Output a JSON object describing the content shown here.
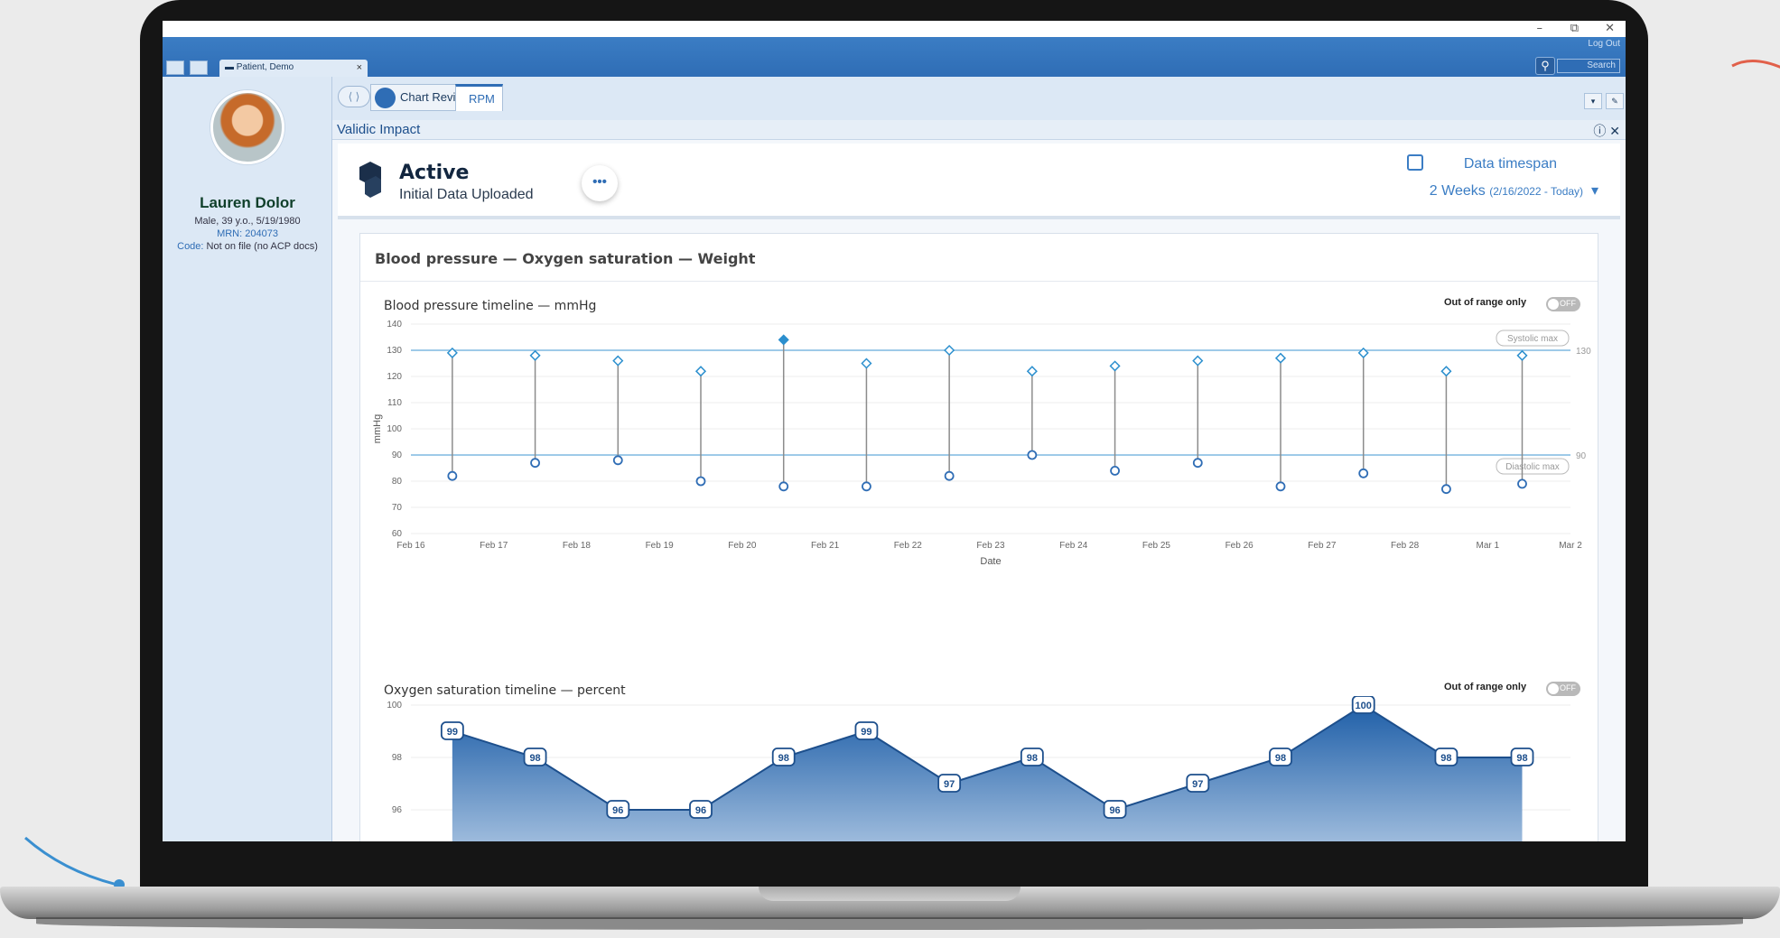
{
  "window": {
    "minimize": "–",
    "restore": "⧉",
    "close": "✕"
  },
  "header": {
    "patient_tab": "Patient, Demo",
    "patient_tab_close": "×",
    "logout": "Log Out",
    "search_placeholder": "Search"
  },
  "patient": {
    "name": "Lauren Dolor",
    "demographics": "Male, 39 y.o., 5/19/1980",
    "mrn": "MRN: 204073",
    "code_label": "Code:",
    "code_value": "Not on file (no ACP docs)"
  },
  "nav": {
    "tabs": [
      {
        "label": "Chart Review"
      },
      {
        "label": "RPM"
      }
    ]
  },
  "content": {
    "title": "Validic Impact",
    "status": "Active",
    "status_sub": "Initial Data Uploaded",
    "more": "•••",
    "timespan_label": "Data timespan",
    "timespan_value": "2 Weeks",
    "timespan_dates": "(2/16/2022 - Today)",
    "card_title": "Blood pressure — Oxygen saturation — Weight",
    "out_of_range_label": "Out of range only",
    "toggle_state": "OFF"
  },
  "colors": {
    "accent": "#2f6db5",
    "marker": "#2b8fce",
    "threshold": "#7fb8e0"
  },
  "chart_data": [
    {
      "type": "line",
      "title": "Blood pressure timeline — mmHg",
      "xlabel": "Date",
      "ylabel": "mmHg",
      "ylim": [
        60,
        140
      ],
      "yticks": [
        60,
        70,
        80,
        90,
        100,
        110,
        120,
        130,
        140
      ],
      "x_ticks": [
        "Feb 16",
        "Feb 17",
        "Feb 18",
        "Feb 19",
        "Feb 20",
        "Feb 21",
        "Feb 22",
        "Feb 23",
        "Feb 24",
        "Feb 25",
        "Feb 26",
        "Feb 27",
        "Feb 28",
        "Mar 1",
        "Mar 2"
      ],
      "x": [
        "2022-02-16T12:00",
        "2022-02-17T12:00",
        "2022-02-18T12:00",
        "2022-02-19T12:00",
        "2022-02-20T12:00",
        "2022-02-21T12:00",
        "2022-02-22T12:00",
        "2022-02-23T12:00",
        "2022-02-24T12:00",
        "2022-02-25T12:00",
        "2022-02-26T12:00",
        "2022-02-27T12:00",
        "2022-02-28T12:00",
        "2022-03-01T10:00"
      ],
      "series": [
        {
          "name": "Systolic",
          "values": [
            129,
            128,
            126,
            122,
            134,
            125,
            130,
            122,
            124,
            126,
            127,
            129,
            122,
            128
          ]
        },
        {
          "name": "Diastolic",
          "values": [
            82,
            87,
            88,
            80,
            78,
            78,
            82,
            90,
            84,
            87,
            78,
            83,
            77,
            79
          ]
        }
      ],
      "thresholds": [
        {
          "label": "Systolic max",
          "value": 130
        },
        {
          "label": "Diastolic max",
          "value": 90
        }
      ],
      "grid": true
    },
    {
      "type": "area",
      "title": "Oxygen saturation timeline — percent",
      "ylabel": "percent",
      "ylim": [
        94,
        100
      ],
      "yticks": [
        96,
        98,
        100
      ],
      "x": [
        "2022-02-16T12:00",
        "2022-02-17T12:00",
        "2022-02-18T12:00",
        "2022-02-19T12:00",
        "2022-02-20T12:00",
        "2022-02-21T12:00",
        "2022-02-22T12:00",
        "2022-02-23T12:00",
        "2022-02-24T12:00",
        "2022-02-25T12:00",
        "2022-02-26T12:00",
        "2022-02-27T12:00",
        "2022-02-28T12:00",
        "2022-03-01T10:00"
      ],
      "series": [
        {
          "values": [
            99,
            98,
            96,
            96,
            98,
            99,
            97,
            98,
            96,
            97,
            98,
            100,
            98,
            98
          ]
        }
      ],
      "grid": true
    }
  ]
}
